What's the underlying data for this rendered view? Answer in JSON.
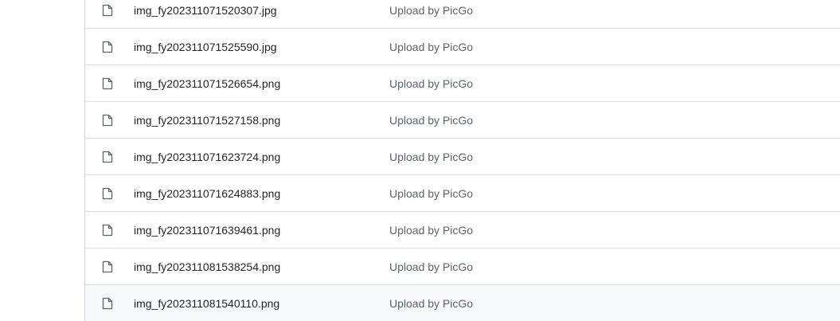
{
  "files": [
    {
      "name": "img_fy202311071520307.jpg",
      "commit_message": "Upload by PicGo",
      "icon": "file-icon"
    },
    {
      "name": "img_fy202311071525590.jpg",
      "commit_message": "Upload by PicGo",
      "icon": "file-icon"
    },
    {
      "name": "img_fy202311071526654.png",
      "commit_message": "Upload by PicGo",
      "icon": "file-icon"
    },
    {
      "name": "img_fy202311071527158.png",
      "commit_message": "Upload by PicGo",
      "icon": "file-icon"
    },
    {
      "name": "img_fy202311071623724.png",
      "commit_message": "Upload by PicGo",
      "icon": "file-icon"
    },
    {
      "name": "img_fy202311071624883.png",
      "commit_message": "Upload by PicGo",
      "icon": "file-icon"
    },
    {
      "name": "img_fy202311071639461.png",
      "commit_message": "Upload by PicGo",
      "icon": "file-icon"
    },
    {
      "name": "img_fy202311081538254.png",
      "commit_message": "Upload by PicGo",
      "icon": "file-icon"
    },
    {
      "name": "img_fy202311081540110.png",
      "commit_message": "Upload by PicGo",
      "icon": "file-icon"
    }
  ],
  "colors": {
    "file_name": "#1f2328",
    "commit_message": "#59636e",
    "row_border": "#d8dee4",
    "hover_background": "#f6f8fa",
    "icon": "#59636e"
  }
}
